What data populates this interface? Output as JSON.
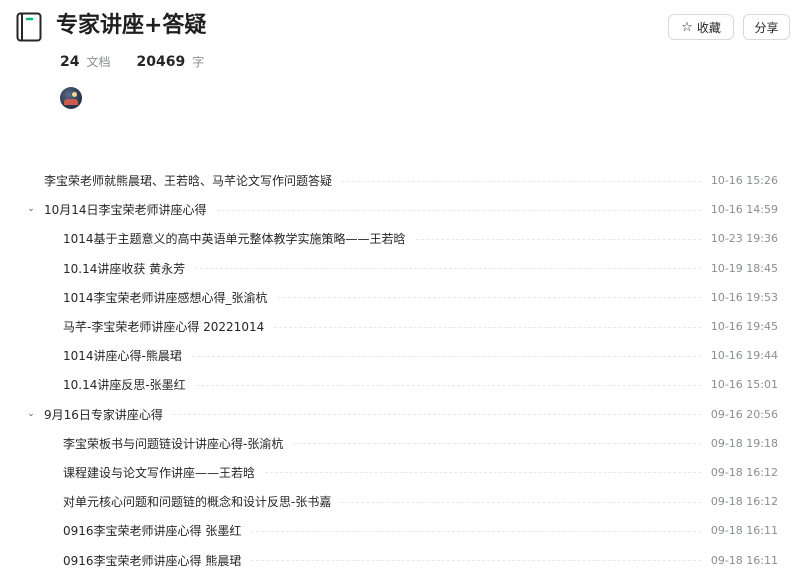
{
  "header": {
    "title": "专家讲座+答疑",
    "favorite_label": "收藏",
    "share_label": "分享"
  },
  "stats": {
    "docs_count": "24",
    "docs_unit": "文档",
    "words_count": "20469",
    "words_unit": "字"
  },
  "items": [
    {
      "label": "李宝荣老师就熊晨珺、王若晗、马芊论文写作问题答疑",
      "time": "10-16 15:26"
    },
    {
      "label": "10月14日李宝荣老师讲座心得",
      "time": "10-16 14:59"
    },
    {
      "label": "1014基于主题意义的高中英语单元整体教学实施策略——王若晗",
      "time": "10-23 19:36"
    },
    {
      "label": "10.14讲座收获 黄永芳",
      "time": "10-19 18:45"
    },
    {
      "label": "1014李宝荣老师讲座感想心得_张渝杭",
      "time": "10-16 19:53"
    },
    {
      "label": "马芊-李宝荣老师讲座心得 20221014",
      "time": "10-16 19:45"
    },
    {
      "label": "1014讲座心得-熊晨珺",
      "time": "10-16 19:44"
    },
    {
      "label": "10.14讲座反思-张墨红",
      "time": "10-16 15:01"
    },
    {
      "label": "9月16日专家讲座心得",
      "time": "09-16 20:56"
    },
    {
      "label": "李宝荣板书与问题链设计讲座心得-张渝杭",
      "time": "09-18 19:18"
    },
    {
      "label": "课程建设与论文写作讲座——王若晗",
      "time": "09-18 16:12"
    },
    {
      "label": "对单元核心问题和问题链的概念和设计反思-张书嘉",
      "time": "09-18 16:12"
    },
    {
      "label": "0916李宝荣老师讲座心得 张墨红",
      "time": "09-18 16:11"
    },
    {
      "label": "0916李宝荣老师讲座心得 熊晨珺",
      "time": "09-18 16:11"
    }
  ]
}
